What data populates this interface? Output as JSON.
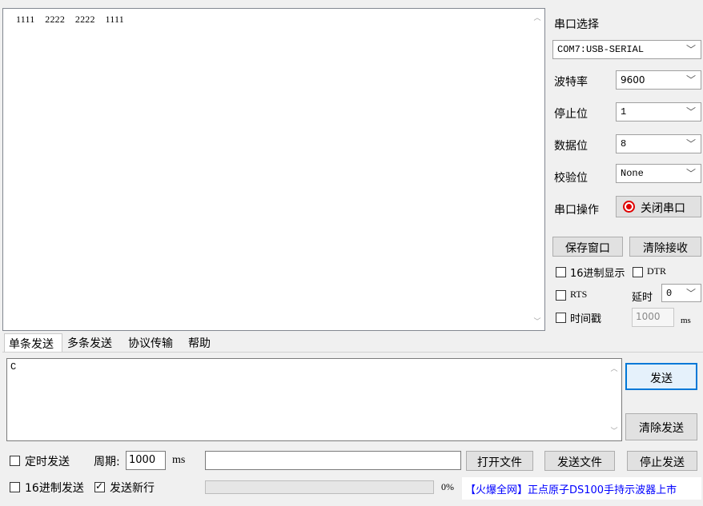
{
  "receive": {
    "text": "1111    2222    2222    1111"
  },
  "serial": {
    "port_label": "串口选择",
    "port_value": "COM7:USB-SERIAL",
    "baud_label": "波特率",
    "baud_value": "9600",
    "stop_label": "停止位",
    "stop_value": "1",
    "data_label": "数据位",
    "data_value": "8",
    "parity_label": "校验位",
    "parity_value": "None",
    "op_label": "串口操作",
    "op_button": "关闭串口",
    "save_window": "保存窗口",
    "clear_receive": "清除接收",
    "hex_display": "16进制显示",
    "dtr": "DTR",
    "rts": "RTS",
    "delay_label": "延时",
    "delay_value": "0",
    "timestamp_label": "时间戳",
    "timestamp_value": "1000",
    "timestamp_unit": "ms"
  },
  "tabs": [
    "单条发送",
    "多条发送",
    "协议传输",
    "帮助"
  ],
  "send": {
    "text": "C",
    "send_button": "发送",
    "clear_send": "清除发送",
    "timed_send": "定时发送",
    "period_label": "周期:",
    "period_value": "1000",
    "period_unit": "ms",
    "open_file": "打开文件",
    "send_file": "发送文件",
    "stop_send": "停止发送",
    "hex_send": "16进制发送",
    "send_newline": "发送新行",
    "progress_text": "0%",
    "progress": 0,
    "ad": "【火爆全网】正点原子DS100手持示波器上市"
  },
  "colors": {
    "accent": "#0078d7",
    "indicator": "#e00000",
    "ad_text": "#0000ff"
  }
}
